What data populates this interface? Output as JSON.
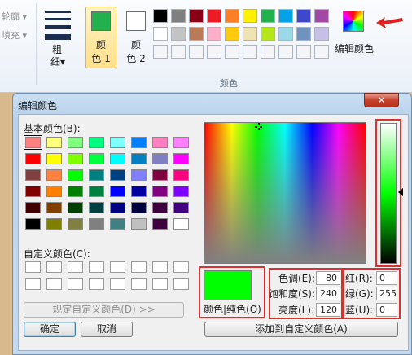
{
  "ribbon": {
    "outline_label": "轮廓",
    "fill_label": "填充",
    "size_label": "粗",
    "size_label2": "细",
    "color1_label1": "颜",
    "color1_label2": "色 1",
    "color2_label1": "颜",
    "color2_label2": "色 2",
    "edit_colors_label": "编辑颜色",
    "group_label": "颜色",
    "color1": "#22b14c",
    "color2": "#ffffff",
    "palette_row1": [
      "#000000",
      "#7f7f7f",
      "#880015",
      "#ed1c24",
      "#ff7f27",
      "#fff200",
      "#22b14c",
      "#00a2e8",
      "#3f48cc",
      "#a349a4"
    ],
    "palette_row2": [
      "#ffffff",
      "#c3c3c3",
      "#b97a57",
      "#ffaec9",
      "#ffc90e",
      "#efe4b0",
      "#b5e61d",
      "#99d9ea",
      "#7092be",
      "#c8bfe7"
    ]
  },
  "dialog": {
    "title": "编辑颜色",
    "close_symbol": "✕",
    "basic_colors_label": "基本颜色(B):",
    "basic_colors": [
      [
        "#ff8080",
        "#ffff80",
        "#80ff80",
        "#00ff80",
        "#80ffff",
        "#0080ff",
        "#ff80c0",
        "#ff80ff"
      ],
      [
        "#ff0000",
        "#ffff00",
        "#80ff00",
        "#00ff40",
        "#00ffff",
        "#0080c0",
        "#8080c0",
        "#ff00ff"
      ],
      [
        "#804040",
        "#ff8040",
        "#00ff00",
        "#008080",
        "#004080",
        "#8080ff",
        "#800040",
        "#ff0080"
      ],
      [
        "#800000",
        "#ff8000",
        "#008000",
        "#008040",
        "#0000ff",
        "#0000a0",
        "#800080",
        "#8000ff"
      ],
      [
        "#400000",
        "#804000",
        "#004000",
        "#004040",
        "#000080",
        "#000040",
        "#400040",
        "#400080"
      ],
      [
        "#000000",
        "#808000",
        "#808040",
        "#808080",
        "#408080",
        "#c0c0c0",
        "#400040",
        "#ffffff"
      ]
    ],
    "custom_colors_label": "自定义颜色(C):",
    "define_custom_button": "规定自定义颜色(D) >>",
    "ok_button": "确定",
    "cancel_button": "取消",
    "color_solid_label": "颜色|纯色(O)",
    "hue_label": "色调(E):",
    "sat_label": "饱和度(S):",
    "lum_label": "亮度(L):",
    "red_label": "红(R):",
    "green_label": "绿(G):",
    "blue_label": "蓝(U):",
    "hue_value": "80",
    "sat_value": "240",
    "lum_value": "120",
    "red_value": "0",
    "green_value": "255",
    "blue_value": "0",
    "add_custom_button": "添加到自定义颜色(A)",
    "current_color": "#00ff00"
  }
}
